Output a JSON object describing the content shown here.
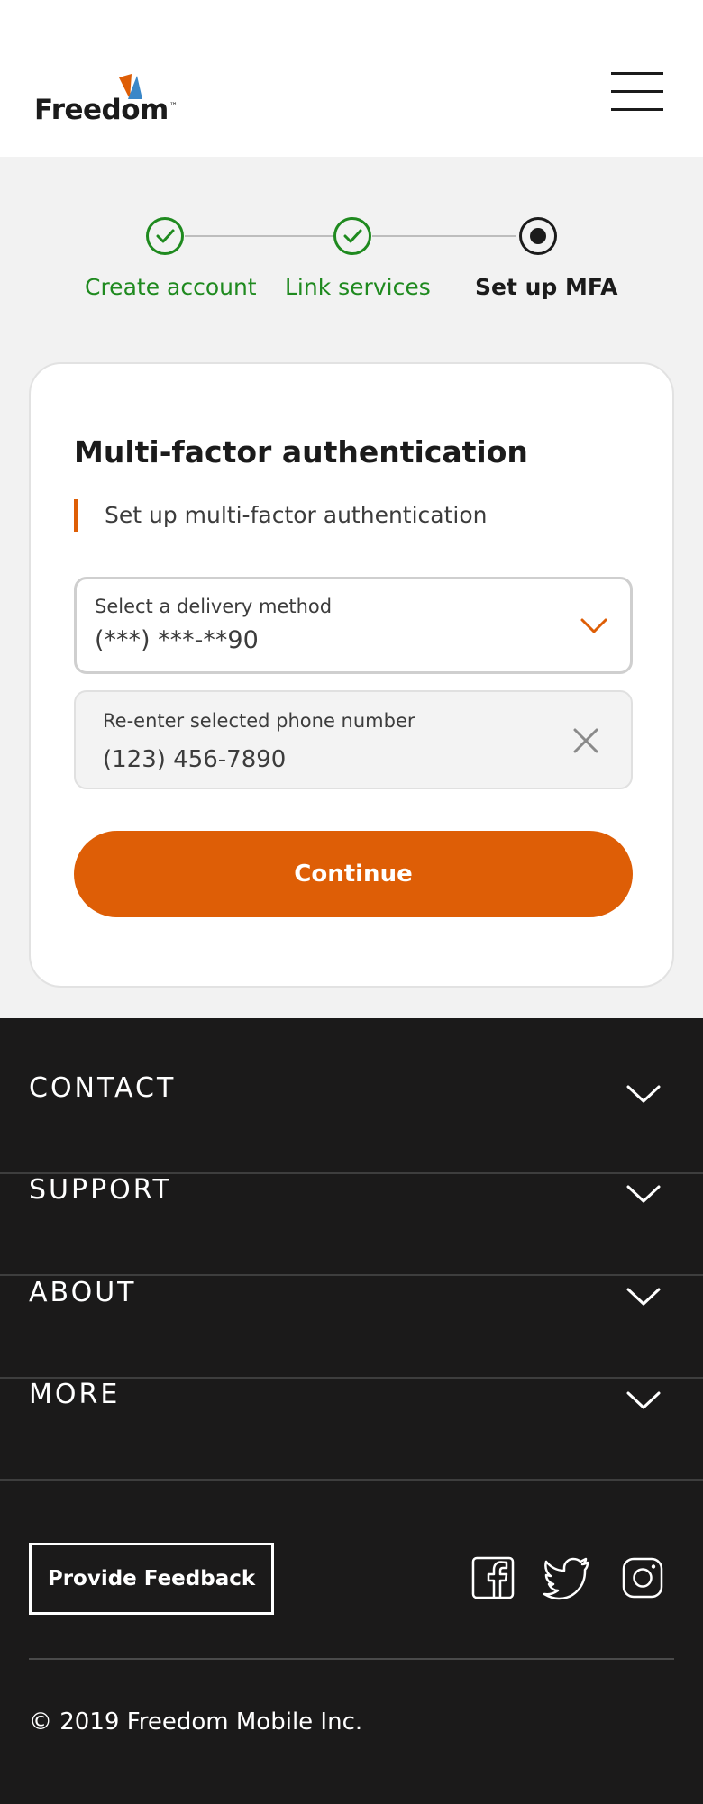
{
  "header": {
    "logo_text": "Freedom",
    "logo_tm": "™",
    "menu_icon": "hamburger-icon"
  },
  "stepper": {
    "steps": [
      {
        "label": "Create account",
        "state": "done"
      },
      {
        "label": "Link services",
        "state": "done"
      },
      {
        "label": "Set up MFA",
        "state": "current"
      }
    ]
  },
  "card": {
    "title": "Multi-factor authentication",
    "subtitle": "Set up multi-factor authentication",
    "delivery": {
      "label": "Select a delivery method",
      "value": "(***) ***-**90"
    },
    "phone": {
      "label": "Re-enter selected phone number",
      "value": "(123) 456-7890"
    },
    "continue_label": "Continue"
  },
  "footer": {
    "sections": [
      "CONTACT",
      "SUPPORT",
      "ABOUT",
      "MORE"
    ],
    "feedback_label": "Provide Feedback",
    "social_icons": [
      "facebook-icon",
      "twitter-icon",
      "instagram-icon"
    ],
    "copyright": "© 2019 Freedom Mobile Inc."
  },
  "colors": {
    "accent": "#de5e06",
    "success": "#1f8a1f",
    "footer_bg": "#1b1a1a"
  }
}
